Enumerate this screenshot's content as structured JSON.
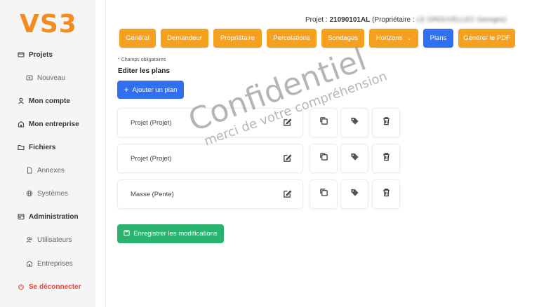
{
  "brand": {
    "logo_text": "VS3",
    "logo_color": "#f28c1e"
  },
  "sidebar": {
    "items": [
      {
        "label": "Projets",
        "icon": "projects-icon",
        "level": 0
      },
      {
        "label": "Nouveau",
        "icon": "new-folder-icon",
        "level": 1
      },
      {
        "label": "Mon compte",
        "icon": "user-icon",
        "level": 0
      },
      {
        "label": "Mon entreprise",
        "icon": "building-icon",
        "level": 0
      },
      {
        "label": "Fichiers",
        "icon": "folder-icon",
        "level": 0
      },
      {
        "label": "Annexes",
        "icon": "file-icon",
        "level": 1
      },
      {
        "label": "Systèmes",
        "icon": "globe-icon",
        "level": 1
      },
      {
        "label": "Administration",
        "icon": "admin-icon",
        "level": 0
      },
      {
        "label": "Utilisateurs",
        "icon": "users-icon",
        "level": 1
      },
      {
        "label": "Entreprises",
        "icon": "building-icon",
        "level": 1
      },
      {
        "label": "Se déconnecter",
        "icon": "power-icon",
        "level": 0
      }
    ]
  },
  "header": {
    "project_prefix": "Projet : ",
    "project_number": "21090101AL",
    "owner_prefix": " (Propriétaire : ",
    "owner_name": "LE GROUVELLEC Georges)"
  },
  "tabs": [
    {
      "label": "Général",
      "active": false
    },
    {
      "label": "Demandeur",
      "active": false
    },
    {
      "label": "Propriétaire",
      "active": false
    },
    {
      "label": "Percolations",
      "active": false
    },
    {
      "label": "Sondages",
      "active": false
    },
    {
      "label": "Horizons",
      "active": false,
      "dropdown": true
    },
    {
      "label": "Plans",
      "active": true
    },
    {
      "label": "Générer le PDF",
      "active": false
    }
  ],
  "form": {
    "required_note": "Champs obligatoires",
    "section_title": "Editer les plans",
    "add_button": "Ajouter un plan",
    "plans": [
      {
        "name": "Projet (Projet)"
      },
      {
        "name": "Projet (Projet)"
      },
      {
        "name": "Masse (Pente)"
      }
    ],
    "save_button": "Enregistrer les modifications"
  },
  "watermark": {
    "title": "Confidentiel",
    "subtitle": "merci de votre compréhension"
  },
  "colors": {
    "accent_orange": "#f5a01e",
    "primary_blue": "#2f6ff0",
    "success_green": "#2ab36e",
    "danger_red": "#e8453c"
  }
}
